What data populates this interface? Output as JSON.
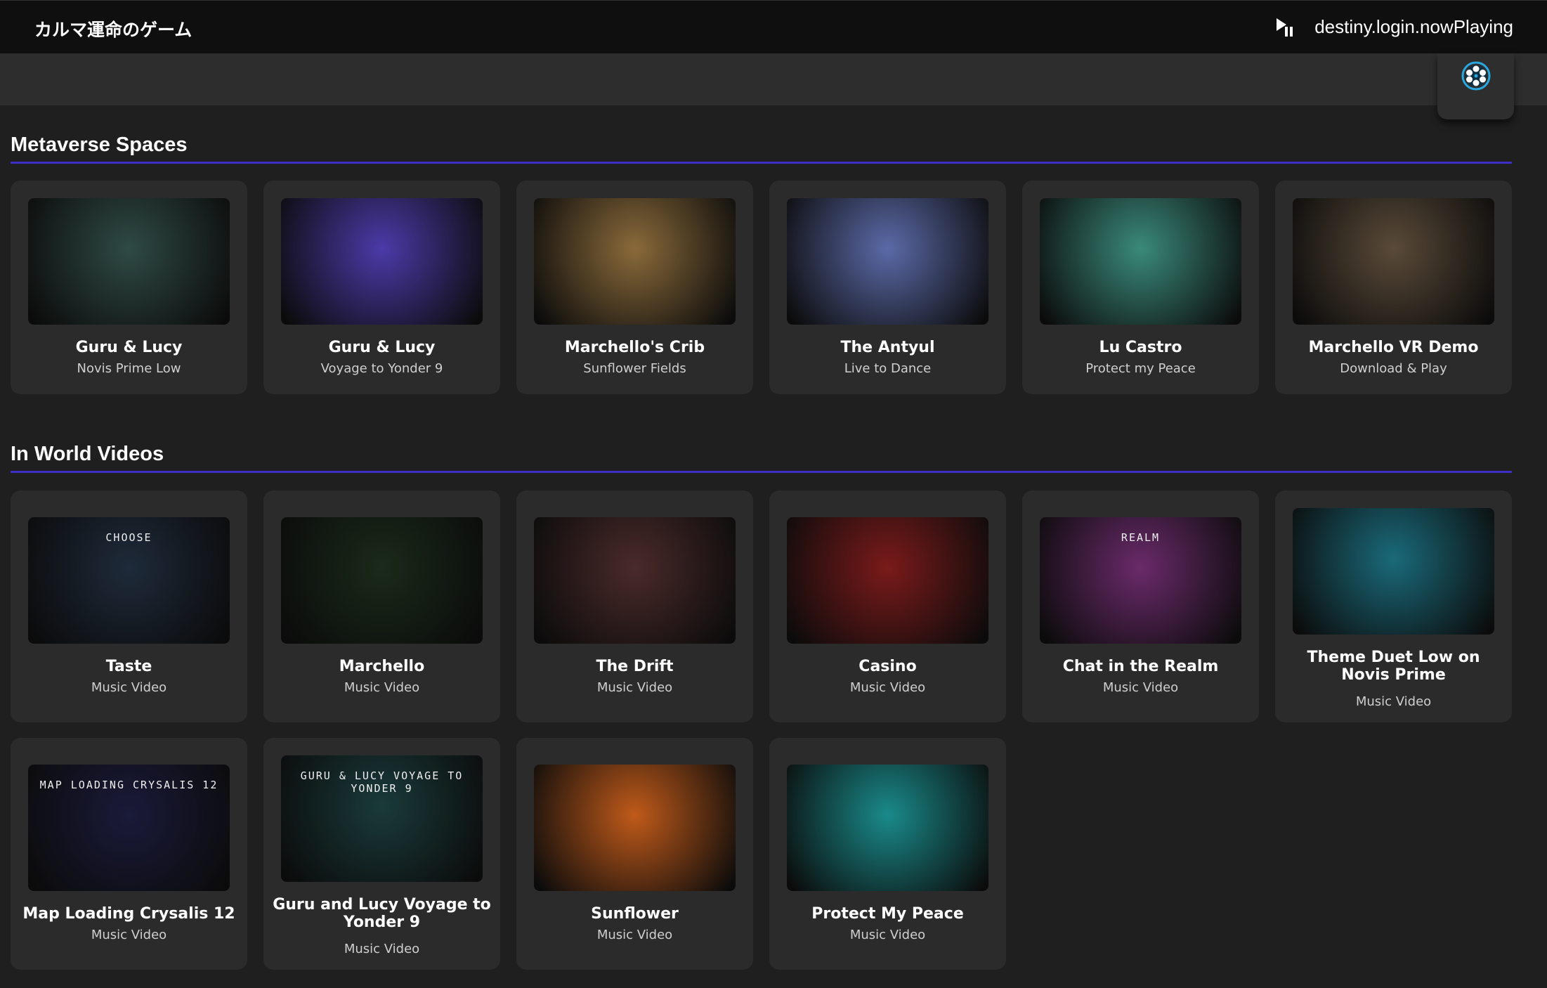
{
  "header": {
    "brand": "カルマ運命のゲーム",
    "now_playing": "destiny.login.nowPlaying"
  },
  "sections": [
    {
      "title": "Metaverse Spaces",
      "cards": [
        {
          "title": "Guru & Lucy",
          "subtitle": "Novis Prime Low",
          "palette": "#2f4a44"
        },
        {
          "title": "Guru & Lucy",
          "subtitle": "Voyage to Yonder 9",
          "palette": "#4b3aa8"
        },
        {
          "title": "Marchello's Crib",
          "subtitle": "Sunflower Fields",
          "palette": "#8a6a3a"
        },
        {
          "title": "The Antyul",
          "subtitle": "Live to Dance",
          "palette": "#5b6aa8"
        },
        {
          "title": "Lu Castro",
          "subtitle": "Protect my Peace",
          "palette": "#3a8a7a"
        },
        {
          "title": "Marchello VR Demo",
          "subtitle": "Download & Play",
          "palette": "#5a4a38"
        }
      ]
    },
    {
      "title": "In World Videos",
      "cards": [
        {
          "title": "Taste",
          "subtitle": "Music Video",
          "palette": "#1e2a3a",
          "overlay": "CHOOSE"
        },
        {
          "title": "Marchello",
          "subtitle": "Music Video",
          "palette": "#1a2a1a"
        },
        {
          "title": "The Drift",
          "subtitle": "Music Video",
          "palette": "#4a2a2a"
        },
        {
          "title": "Casino",
          "subtitle": "Music Video",
          "palette": "#7a1a1a"
        },
        {
          "title": "Chat in the Realm",
          "subtitle": "Music Video",
          "palette": "#6a2a6a",
          "overlay": "REALM"
        },
        {
          "title": "Theme Duet Low on Novis Prime",
          "subtitle": "Music Video",
          "palette": "#1a6a7a"
        },
        {
          "title": "Map Loading Crysalis 12",
          "subtitle": "Music Video",
          "palette": "#1a1a3a",
          "overlay": "MAP LOADING CRYSALIS 12"
        },
        {
          "title": "Guru and Lucy Voyage to Yonder 9",
          "subtitle": "Music Video",
          "palette": "#1a3a3a",
          "overlay": "GURU & LUCY VOYAGE TO YONDER 9"
        },
        {
          "title": "Sunflower",
          "subtitle": "Music Video",
          "palette": "#c05a1a"
        },
        {
          "title": "Protect My Peace",
          "subtitle": "Music Video",
          "palette": "#1a8a8a"
        }
      ]
    }
  ],
  "icons": {
    "now_playing": "play-pause-icon",
    "hub": "film-reel-icon"
  }
}
